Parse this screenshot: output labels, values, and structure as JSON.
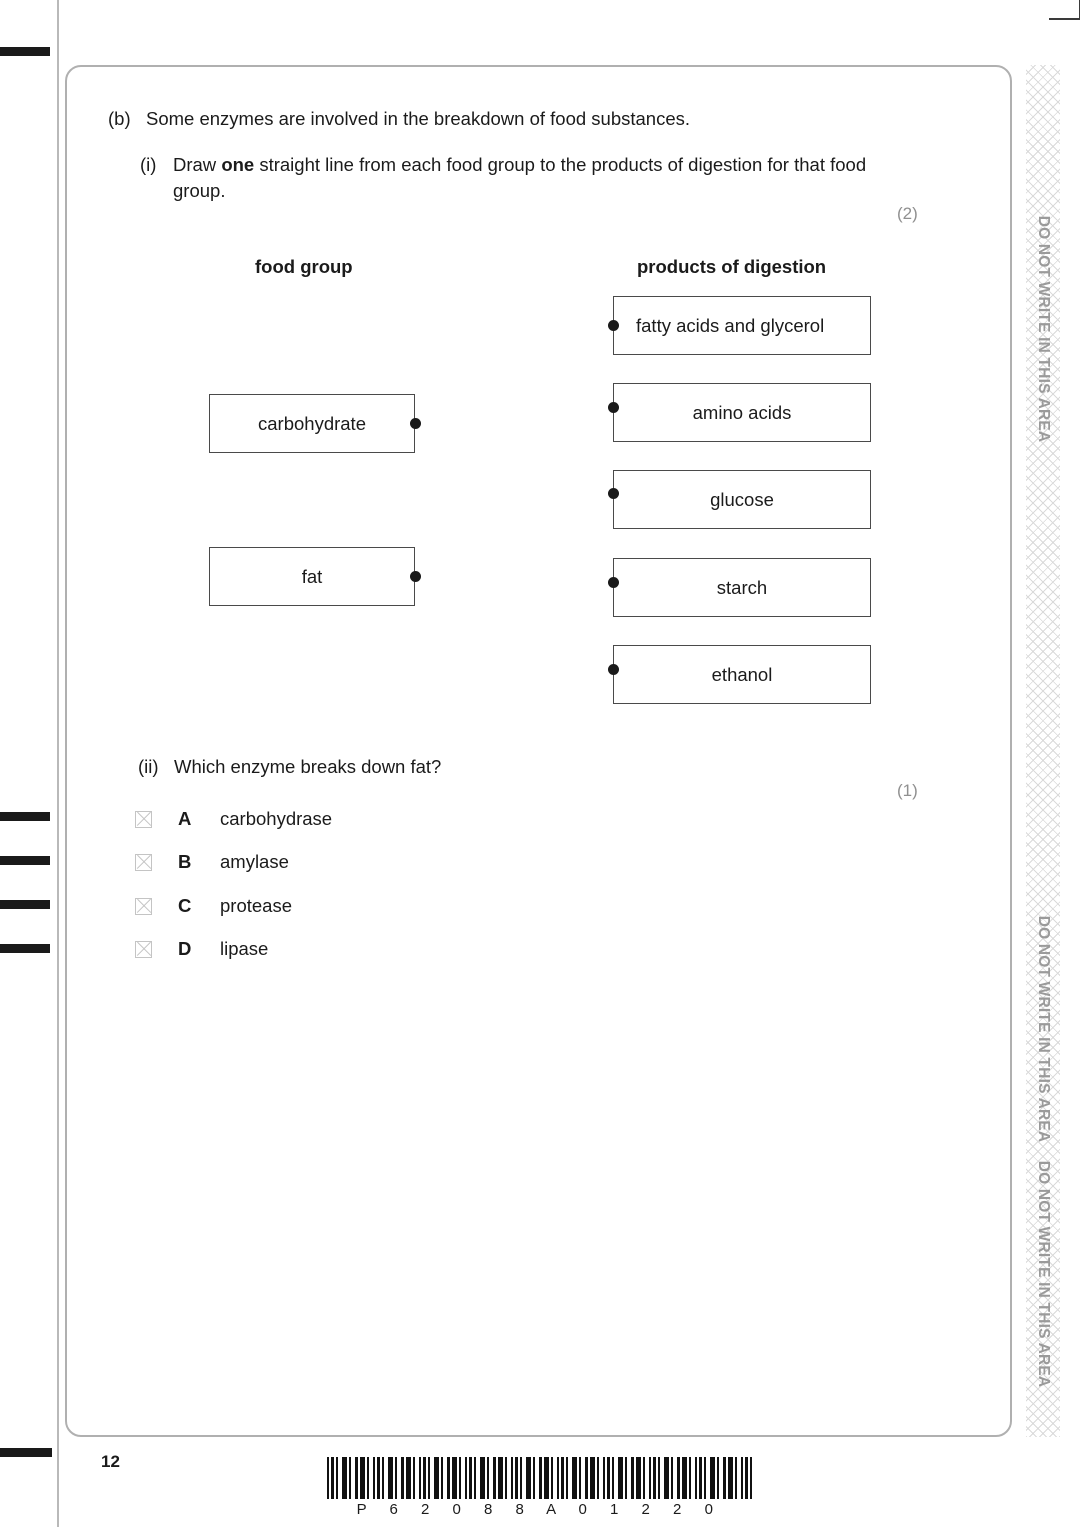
{
  "question": {
    "part_label": "(b)",
    "part_text": "Some enzymes are involved in the breakdown of food substances.",
    "sub_i_label": "(i)",
    "sub_i_text_before": "Draw ",
    "sub_i_emphasis": "one",
    "sub_i_text_after": " straight line from each food group to the products of digestion for that food group.",
    "marks_i": "(2)",
    "marks_ii": "(1)"
  },
  "matching": {
    "left_heading": "food group",
    "right_heading": "products of digestion",
    "left_items": [
      {
        "label": "carbohydrate"
      },
      {
        "label": "fat"
      }
    ],
    "right_items": [
      {
        "label": "fatty acids and glycerol"
      },
      {
        "label": "amino acids"
      },
      {
        "label": "glucose"
      },
      {
        "label": "starch"
      },
      {
        "label": "ethanol"
      }
    ]
  },
  "mcq": {
    "label": "(ii)",
    "question": "Which enzyme breaks down fat?",
    "options": [
      {
        "letter": "A",
        "text": "carbohydrase"
      },
      {
        "letter": "B",
        "text": "amylase"
      },
      {
        "letter": "C",
        "text": "protease"
      },
      {
        "letter": "D",
        "text": "lipase"
      }
    ]
  },
  "sidebar": {
    "notice": "DO NOT WRITE IN THIS AREA"
  },
  "footer": {
    "page_number": "12",
    "barcode_text": "P 6 2 0 8 8 A 0 1 2 2 0"
  }
}
